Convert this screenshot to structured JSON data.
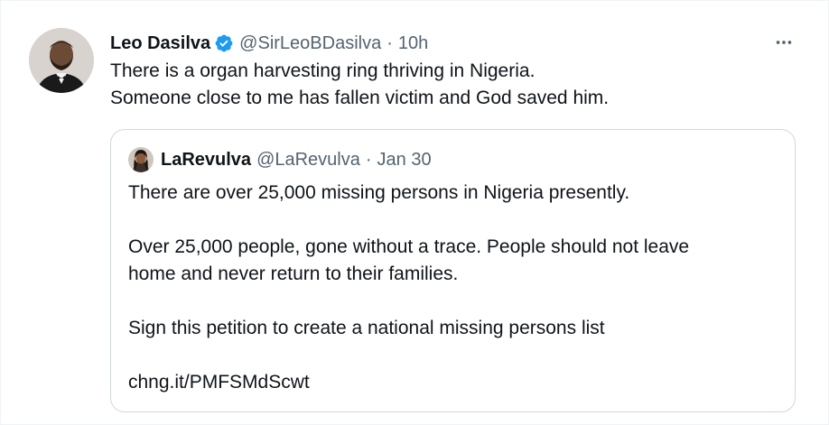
{
  "tweet": {
    "author": {
      "name": "Leo Dasilva",
      "handle": "@SirLeoBDasilva",
      "separator": "·",
      "time": "10h",
      "verified": true,
      "avatar": "avatar-photo"
    },
    "more_icon": "more-horizontal-icon",
    "text_lines": [
      "There is a organ harvesting ring thriving in Nigeria.",
      "Someone close to me has fallen victim and God saved him."
    ]
  },
  "quoted_tweet": {
    "author": {
      "name": "LaRevulva",
      "handle": "@LaRevulva",
      "separator": "·",
      "time": "Jan 30",
      "avatar": "avatar-photo"
    },
    "paragraphs": {
      "p1": "There are over 25,000 missing persons in Nigeria presently.",
      "p2_line1": "Over 25,000 people, gone without a trace. People should not leave",
      "p2_line2": "home and never return to their families.",
      "p3": "Sign this petition to create a national missing persons list",
      "link": "chng.it/PMFSMdScwt"
    }
  },
  "colors": {
    "text_primary": "#0f1419",
    "text_secondary": "#536471",
    "verified_blue": "#1d9bf0",
    "border": "#cfd9de"
  }
}
